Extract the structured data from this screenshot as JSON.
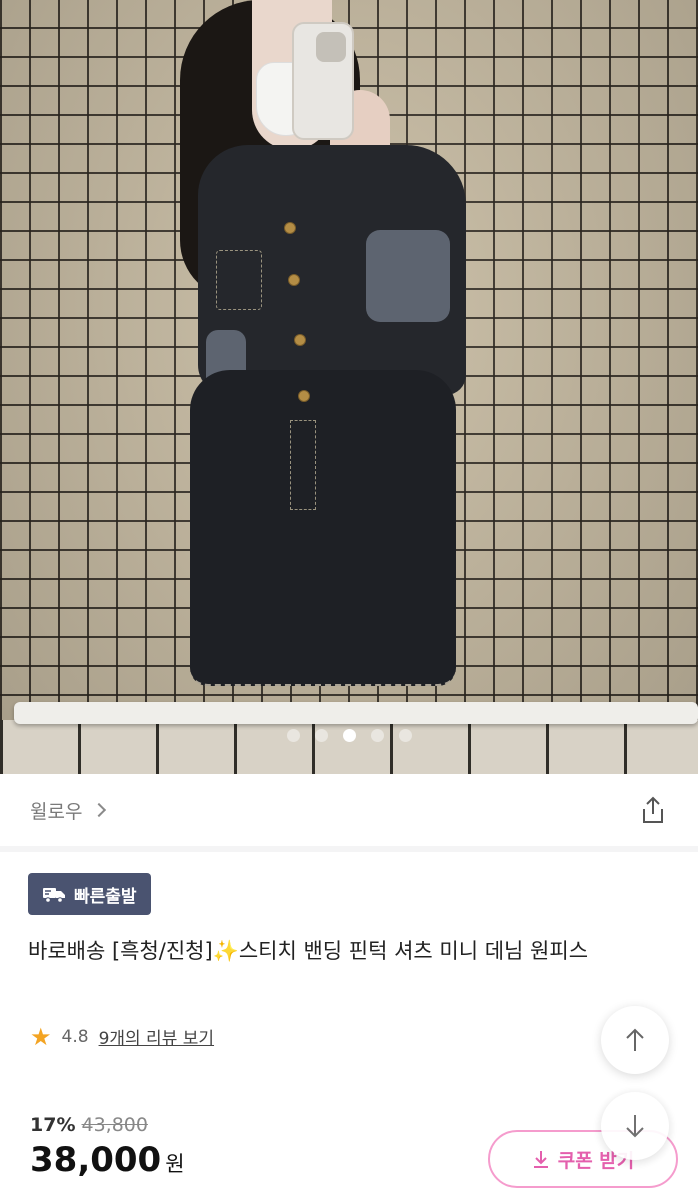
{
  "gallery": {
    "slide_count": 5,
    "active_index": 2
  },
  "store": {
    "name": "윌로우",
    "chevron_icon": "chevron-right-icon",
    "share_icon": "share-icon"
  },
  "product": {
    "badge_label": "빠른출발",
    "badge_icon": "truck-icon",
    "title": "바로배송 [흑청/진청]✨스티치 밴딩 핀턱 셔츠 미니 데님 원피스",
    "rating": "4.8",
    "review_link": "9개의 리뷰 보기",
    "discount": "17%",
    "original_price": "43,800",
    "price": "38,000",
    "currency": "원"
  },
  "coupon_button": {
    "label": "쿠폰 받기",
    "icon": "download-icon"
  },
  "colors": {
    "badge_bg": "#4a5370",
    "coupon_accent": "#e45fad",
    "star": "#f3a423"
  }
}
